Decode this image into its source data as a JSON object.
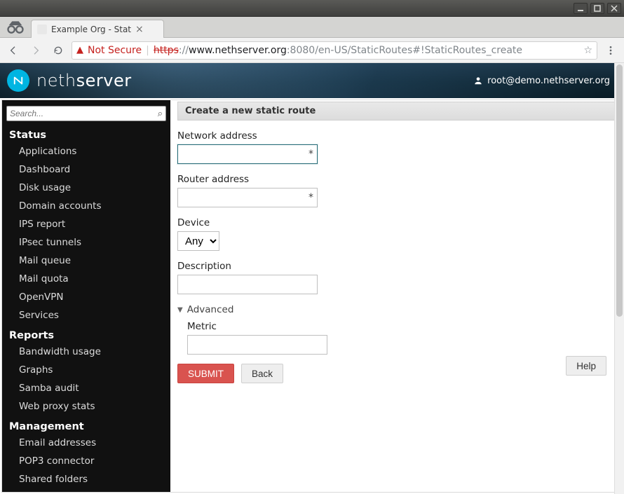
{
  "window": {
    "title": "Example Org - Stat"
  },
  "browser": {
    "tab_title": "Example Org - Stat",
    "not_secure_label": "Not Secure",
    "url_scheme": "https",
    "url_host": "www.nethserver.org",
    "url_port": ":8080",
    "url_path": "/en-US/StaticRoutes#!StaticRoutes_create"
  },
  "banner": {
    "brand_a": "neth",
    "brand_b": "server",
    "user": "root@demo.nethserver.org"
  },
  "sidebar": {
    "search_placeholder": "Search...",
    "sections": [
      {
        "title": "Status",
        "items": [
          "Applications",
          "Dashboard",
          "Disk usage",
          "Domain accounts",
          "IPS report",
          "IPsec tunnels",
          "Mail queue",
          "Mail quota",
          "OpenVPN",
          "Services"
        ]
      },
      {
        "title": "Reports",
        "items": [
          "Bandwidth usage",
          "Graphs",
          "Samba audit",
          "Web proxy stats"
        ]
      },
      {
        "title": "Management",
        "items": [
          "Email addresses",
          "POP3 connector",
          "Shared folders"
        ]
      }
    ]
  },
  "form": {
    "panel_title": "Create a new static route",
    "network_label": "Network address",
    "network_value": "",
    "router_label": "Router address",
    "router_value": "",
    "device_label": "Device",
    "device_value": "Any",
    "description_label": "Description",
    "description_value": "",
    "advanced_label": "Advanced",
    "metric_label": "Metric",
    "metric_value": "",
    "submit_label": "SUBMIT",
    "back_label": "Back",
    "help_label": "Help"
  }
}
